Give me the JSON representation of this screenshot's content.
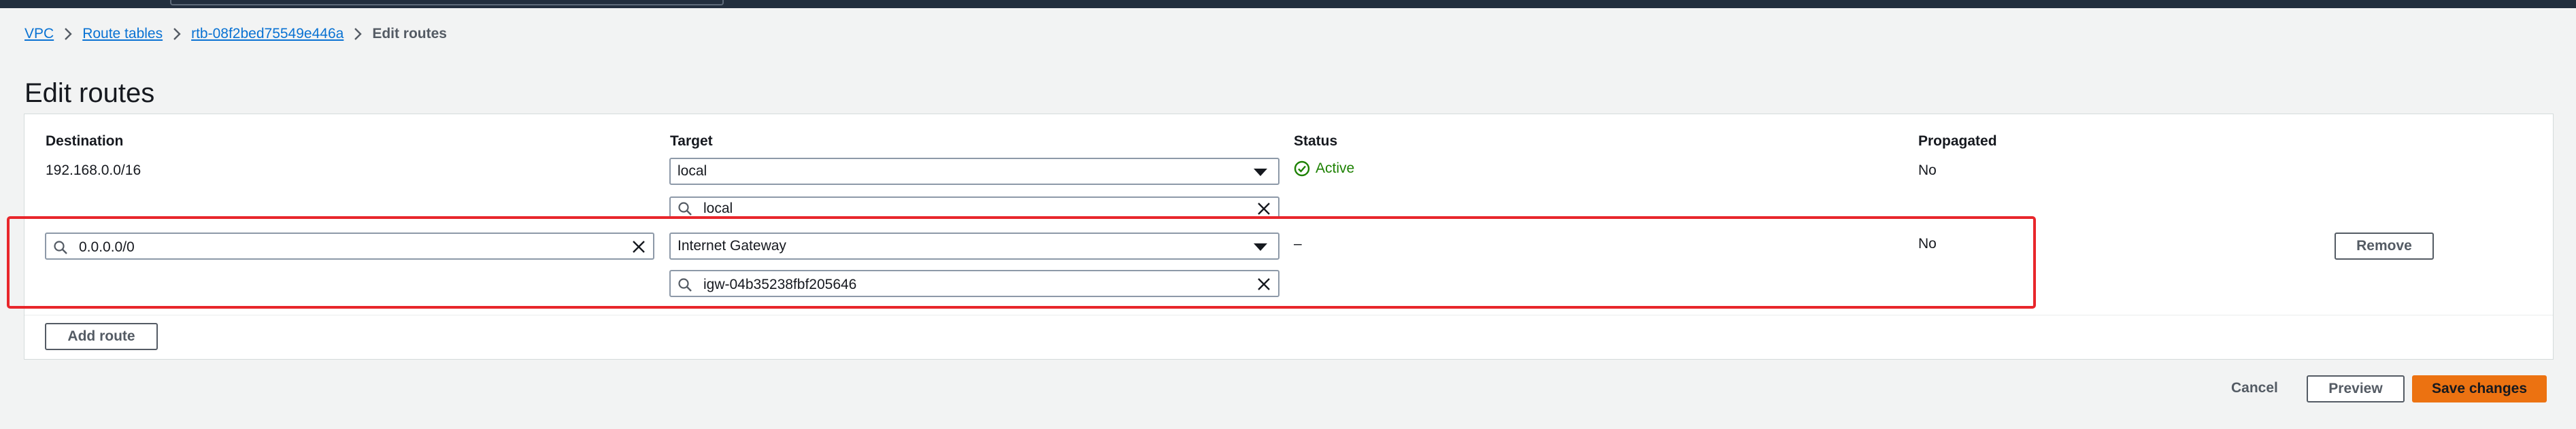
{
  "breadcrumb": {
    "items": [
      "VPC",
      "Route tables",
      "rtb-08f2bed75549e446a"
    ],
    "current": "Edit routes"
  },
  "page": {
    "title": "Edit routes"
  },
  "table": {
    "headers": {
      "destination": "Destination",
      "target": "Target",
      "status": "Status",
      "propagated": "Propagated"
    },
    "routes": [
      {
        "destination": "192.168.0.0/16",
        "target_type": "local",
        "target_value": "local",
        "status": "Active",
        "propagated": "No"
      },
      {
        "destination": "0.0.0.0/0",
        "target_type": "Internet Gateway",
        "target_value": "igw-04b35238fbf205646",
        "status": "–",
        "propagated": "No",
        "remove_label": "Remove"
      }
    ]
  },
  "actions": {
    "add_route": "Add route",
    "cancel": "Cancel",
    "preview": "Preview",
    "save": "Save changes"
  },
  "colors": {
    "accent": "#0972d3",
    "primary_button": "#ec7211",
    "status_active": "#1d8102",
    "highlight_box": "#e8262b"
  },
  "icons": {
    "search": "search-icon",
    "clear": "close-icon",
    "dropdown": "caret-down-icon",
    "status": "check-circle-icon",
    "breadcrumb_separator": "chevron-right-icon"
  }
}
